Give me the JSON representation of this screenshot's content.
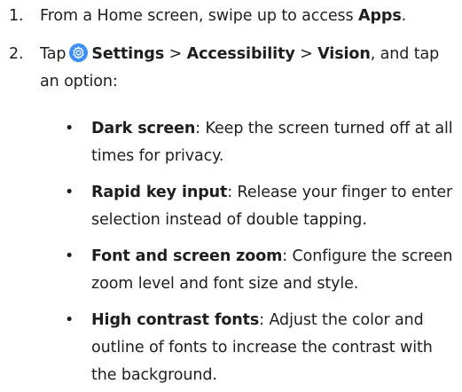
{
  "steps": [
    {
      "number": "1.",
      "pre": "From a Home screen, swipe up to access ",
      "bold": "Apps",
      "post": "."
    },
    {
      "number": "2.",
      "pre": "Tap",
      "icon": "settings-gear-icon",
      "path_1": "Settings",
      "sep_1": ">",
      "path_2": "Accessibility",
      "sep_2": ">",
      "path_3": "Vision",
      "post": ", and tap an option:"
    }
  ],
  "options": [
    {
      "title": "Dark screen",
      "description": ": Keep the screen turned off at all times for privacy."
    },
    {
      "title": "Rapid key input",
      "description": ": Release your finger to enter selection instead of double tapping."
    },
    {
      "title": "Font and screen zoom",
      "description": ": Configure the screen zoom level and font size and style."
    },
    {
      "title": "High contrast fonts",
      "description": ": Adjust the color and outline of fonts to increase the contrast with the background."
    }
  ],
  "bullet_symbol": "•",
  "colors": {
    "text": "#1e1e1e",
    "icon_blue": "#3e8ef7"
  }
}
